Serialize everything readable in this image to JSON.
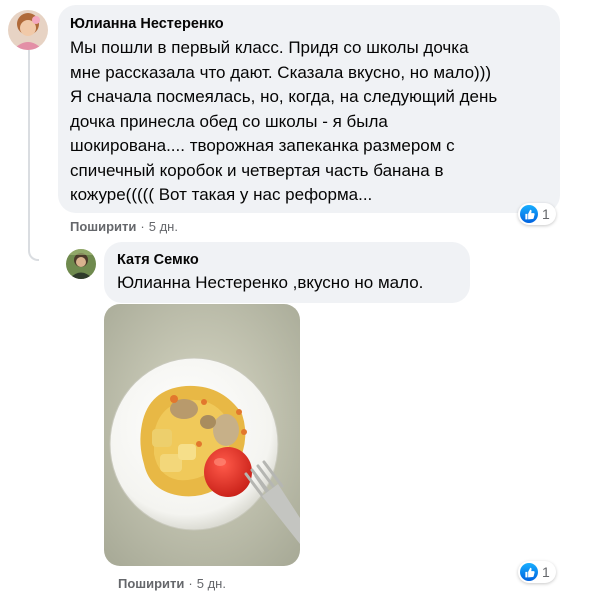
{
  "comments": [
    {
      "author": "Юлианна Нестеренко",
      "text": "Мы пошли в первый класс. Придя со школы дочка\nмне рассказала что дают. Сказала вкусно, но мало)))\nЯ сначала посмеялась, но, когда, на следующий день\nдочка принесла обед со школы - я была\nшокирована.... творожная запеканка размером с\nспичечный коробок и четвертая часть банана в\nкожуре((((( Вот такая у нас реформа...",
      "action_share": "Поширити",
      "separator": "·",
      "time": "5 дн.",
      "reaction_count": "1",
      "reaction_icon": "like-icon"
    },
    {
      "author": "Катя Семко",
      "text": "Юлианна Нестеренко ,вкусно но мало.",
      "action_share": "Поширити",
      "separator": "·",
      "time": "5 дн.",
      "reaction_count": "1",
      "reaction_icon": "like-icon",
      "photo_description_icon": "food-photo"
    }
  ],
  "colors": {
    "bubble_bg": "#f0f2f5",
    "secondary_text": "#65676b",
    "like_blue": "#1877f2",
    "thread_line": "#dadde1"
  }
}
